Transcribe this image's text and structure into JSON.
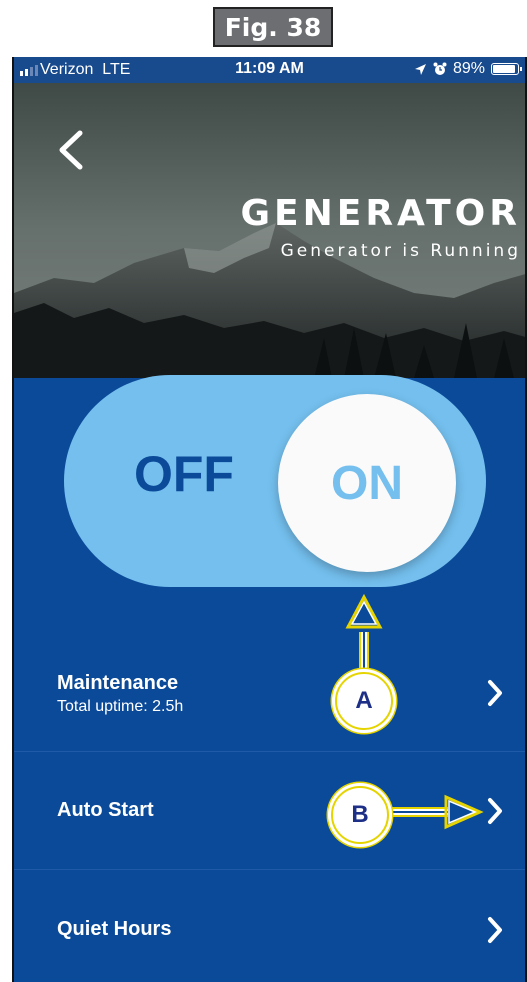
{
  "figure_label": "Fig. 38",
  "status_bar": {
    "carrier": "Verizon",
    "network": "LTE",
    "time": "11:09 AM",
    "battery_percent": "89%",
    "icons": [
      "signal-icon",
      "location-arrow-icon",
      "alarm-icon",
      "battery-icon"
    ]
  },
  "header": {
    "title": "GENERATOR",
    "subtitle": "Generator is Running",
    "back_icon": "back-chevron-icon"
  },
  "power_toggle": {
    "off_label": "OFF",
    "on_label": "ON",
    "state": "on"
  },
  "menu": [
    {
      "title": "Maintenance",
      "subtitle": "Total uptime: 2.5h"
    },
    {
      "title": "Auto Start",
      "subtitle": ""
    },
    {
      "title": "Quiet Hours",
      "subtitle": ""
    }
  ],
  "callouts": {
    "a": "A",
    "b": "B"
  },
  "colors": {
    "app_background": "#0b4a99",
    "toggle_track": "#74bfee",
    "toggle_knob": "#fafafa",
    "callout_yellow": "#e5d400",
    "figure_label_bg": "#6d6e71"
  }
}
